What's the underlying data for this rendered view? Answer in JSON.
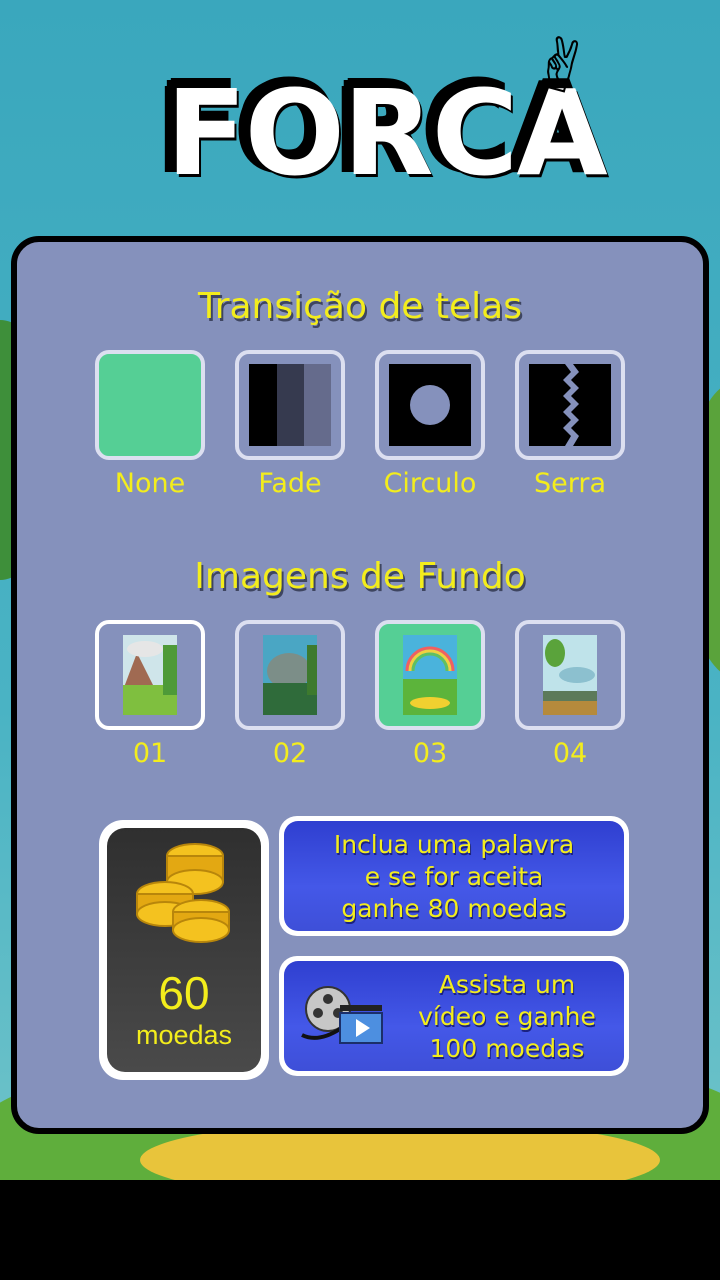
{
  "app": {
    "title": "FORCA"
  },
  "transitions": {
    "title": "Transição de telas",
    "items": [
      {
        "label": "None",
        "icon": "none-transition-icon",
        "selected": true
      },
      {
        "label": "Fade",
        "icon": "fade-transition-icon",
        "selected": false
      },
      {
        "label": "Circulo",
        "icon": "circle-transition-icon",
        "selected": false
      },
      {
        "label": "Serra",
        "icon": "saw-transition-icon",
        "selected": false
      }
    ]
  },
  "backgrounds": {
    "title": "Imagens de Fundo",
    "items": [
      {
        "label": "01",
        "icon": "mountain-landscape-thumbnail",
        "selected": false
      },
      {
        "label": "02",
        "icon": "forest-landscape-thumbnail",
        "selected": false
      },
      {
        "label": "03",
        "icon": "rainbow-landscape-thumbnail",
        "selected": true
      },
      {
        "label": "04",
        "icon": "floating-island-thumbnail",
        "selected": false
      }
    ]
  },
  "coins": {
    "amount": "60",
    "unit": "moedas",
    "icon": "gold-coins-icon"
  },
  "actions": {
    "suggest_word": {
      "line1": "Inclua uma palavra",
      "line2": "e se for aceita",
      "line3": "ganhe 80 moedas"
    },
    "watch_video": {
      "line1": "Assista um",
      "line2": "vídeo e ganhe",
      "line3": "100 moedas",
      "icon": "film-reel-clapper-icon"
    }
  },
  "colors": {
    "accent_yellow": "#f3ed1c",
    "panel": "#8591bc",
    "selected": "#55cf95",
    "button_blue": "#3e4fd8",
    "sky": "#3aa7bd"
  }
}
